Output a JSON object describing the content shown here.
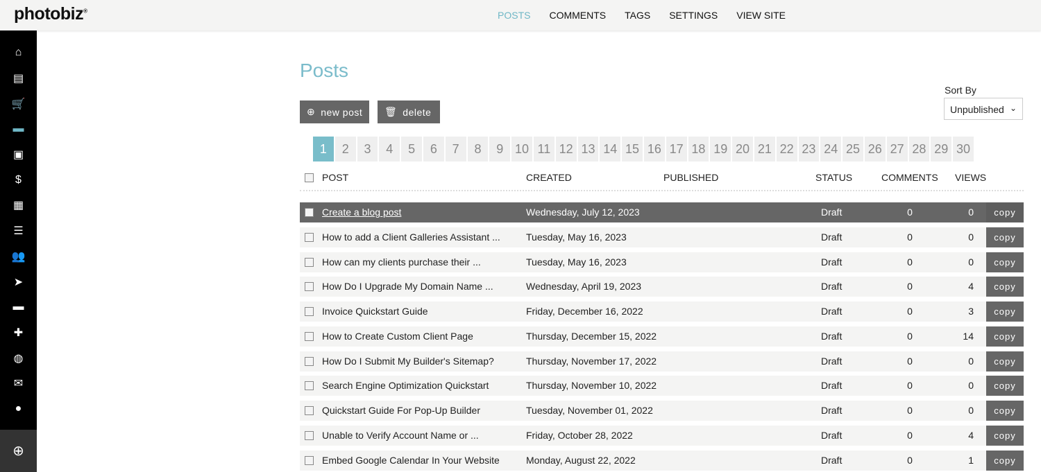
{
  "brand": "photobiz",
  "nav": [
    "POSTS",
    "COMMENTS",
    "TAGS",
    "SETTINGS",
    "VIEW SITE"
  ],
  "nav_active": "POSTS",
  "sidebar_icons": [
    "home-icon",
    "website-icon",
    "cart-icon",
    "blog-icon",
    "gallery-icon",
    "invoice-icon",
    "calendar-icon",
    "list-icon",
    "contacts-icon",
    "send-icon",
    "folder-icon",
    "plugin-icon",
    "globe-icon",
    "mail-icon",
    "account-icon"
  ],
  "page_title": "Posts",
  "buttons": {
    "new_post": "new post",
    "delete": "delete"
  },
  "sort": {
    "label": "Sort By",
    "value": "Unpublished"
  },
  "pages": [
    "1",
    "2",
    "3",
    "4",
    "5",
    "6",
    "7",
    "8",
    "9",
    "10",
    "11",
    "12",
    "13",
    "14",
    "15",
    "16",
    "17",
    "18",
    "19",
    "20",
    "21",
    "22",
    "23",
    "24",
    "25",
    "26",
    "27",
    "28",
    "29",
    "30"
  ],
  "current_page": "1",
  "columns": {
    "post": "POST",
    "created": "CREATED",
    "published": "PUBLISHED",
    "status": "STATUS",
    "comments": "COMMENTS",
    "views": "VIEWS"
  },
  "copy_label": "copy",
  "rows": [
    {
      "title": "Create a blog post",
      "created": "Wednesday, July 12, 2023",
      "published": "",
      "status": "Draft",
      "comments": "0",
      "views": "0"
    },
    {
      "title": "How to add a Client Galleries Assistant ...",
      "created": "Tuesday, May 16, 2023",
      "published": "",
      "status": "Draft",
      "comments": "0",
      "views": "0"
    },
    {
      "title": "How can my clients purchase their ...",
      "created": "Tuesday, May 16, 2023",
      "published": "",
      "status": "Draft",
      "comments": "0",
      "views": "0"
    },
    {
      "title": "How Do I Upgrade My Domain Name ...",
      "created": "Wednesday, April 19, 2023",
      "published": "",
      "status": "Draft",
      "comments": "0",
      "views": "4"
    },
    {
      "title": "Invoice Quickstart Guide",
      "created": "Friday, December 16, 2022",
      "published": "",
      "status": "Draft",
      "comments": "0",
      "views": "3"
    },
    {
      "title": "How to Create Custom Client Page",
      "created": "Thursday, December 15, 2022",
      "published": "",
      "status": "Draft",
      "comments": "0",
      "views": "14"
    },
    {
      "title": "How Do I Submit My Builder's Sitemap?",
      "created": "Thursday, November 17, 2022",
      "published": "",
      "status": "Draft",
      "comments": "0",
      "views": "0"
    },
    {
      "title": "Search Engine Optimization Quickstart",
      "created": "Thursday, November 10, 2022",
      "published": "",
      "status": "Draft",
      "comments": "0",
      "views": "0"
    },
    {
      "title": "Quickstart Guide For Pop-Up Builder",
      "created": "Tuesday, November 01, 2022",
      "published": "",
      "status": "Draft",
      "comments": "0",
      "views": "0"
    },
    {
      "title": "Unable to Verify Account Name or ...",
      "created": "Friday, October 28, 2022",
      "published": "",
      "status": "Draft",
      "comments": "0",
      "views": "4"
    },
    {
      "title": "Embed Google Calendar In Your Website",
      "created": "Monday, August 22, 2022",
      "published": "",
      "status": "Draft",
      "comments": "0",
      "views": "1"
    }
  ],
  "accent": "#79bdca"
}
